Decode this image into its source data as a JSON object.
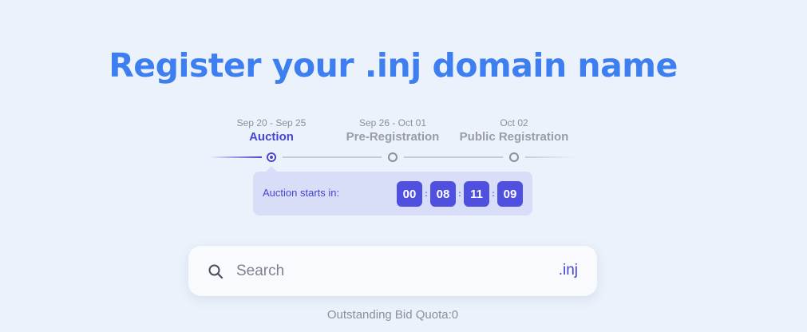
{
  "hero": {
    "title": "Register your .inj domain name"
  },
  "timeline": {
    "steps": [
      {
        "date": "Sep 20 - Sep 25",
        "label": "Auction",
        "active": true
      },
      {
        "date": "Sep 26 - Oct 01",
        "label": "Pre-Registration",
        "active": false
      },
      {
        "date": "Oct 02",
        "label": "Public Registration",
        "active": false
      }
    ]
  },
  "countdown": {
    "label": "Auction starts in:",
    "values": [
      "00",
      "08",
      "11",
      "09"
    ],
    "separator": ":"
  },
  "search": {
    "placeholder": "Search",
    "value": "",
    "suffix": ".inj",
    "icon": "search-icon"
  },
  "quota": {
    "text": "Outstanding Bid Quota:0"
  },
  "colors": {
    "title": "#3d7ff0",
    "accent": "#4646d0",
    "digit_bg": "#4f4fe0",
    "countdown_bg": "#d9def8",
    "page_bg": "#ebf2fb"
  }
}
